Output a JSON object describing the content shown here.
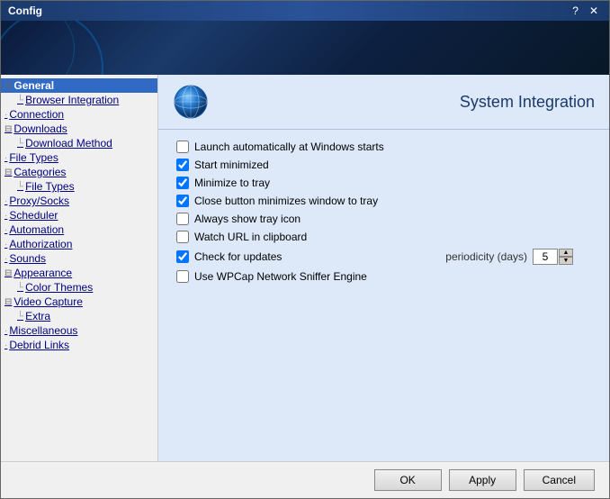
{
  "window": {
    "title": "Config",
    "help_btn": "?",
    "close_btn": "✕"
  },
  "sidebar": {
    "items": [
      {
        "id": "general",
        "label": "General",
        "indent": 0,
        "expand": "□",
        "selected": true,
        "link": true
      },
      {
        "id": "browser-integration",
        "label": "Browser Integration",
        "indent": 1,
        "expand": "",
        "selected": false,
        "link": true
      },
      {
        "id": "connection",
        "label": "Connection",
        "indent": 0,
        "expand": "",
        "selected": false,
        "link": true
      },
      {
        "id": "downloads",
        "label": "Downloads",
        "indent": 0,
        "expand": "□",
        "selected": false,
        "link": true
      },
      {
        "id": "download-method",
        "label": "Download Method",
        "indent": 1,
        "expand": "",
        "selected": false,
        "link": true
      },
      {
        "id": "file-types",
        "label": "File Types",
        "indent": 0,
        "expand": "",
        "selected": false,
        "link": true
      },
      {
        "id": "categories",
        "label": "Categories",
        "indent": 0,
        "expand": "□",
        "selected": false,
        "link": true
      },
      {
        "id": "categories-file-types",
        "label": "File Types",
        "indent": 1,
        "expand": "",
        "selected": false,
        "link": true
      },
      {
        "id": "proxy-socks",
        "label": "Proxy/Socks",
        "indent": 0,
        "expand": "",
        "selected": false,
        "link": true
      },
      {
        "id": "scheduler",
        "label": "Scheduler",
        "indent": 0,
        "expand": "",
        "selected": false,
        "link": true
      },
      {
        "id": "automation",
        "label": "Automation",
        "indent": 0,
        "expand": "",
        "selected": false,
        "link": true
      },
      {
        "id": "authorization",
        "label": "Authorization",
        "indent": 0,
        "expand": "",
        "selected": false,
        "link": true
      },
      {
        "id": "sounds",
        "label": "Sounds",
        "indent": 0,
        "expand": "",
        "selected": false,
        "link": true
      },
      {
        "id": "appearance",
        "label": "Appearance",
        "indent": 0,
        "expand": "□",
        "selected": false,
        "link": true
      },
      {
        "id": "color-themes",
        "label": "Color Themes",
        "indent": 1,
        "expand": "",
        "selected": false,
        "link": true
      },
      {
        "id": "video-capture",
        "label": "Video Capture",
        "indent": 0,
        "expand": "□",
        "selected": false,
        "link": true
      },
      {
        "id": "extra",
        "label": "Extra",
        "indent": 1,
        "expand": "",
        "selected": false,
        "link": true
      },
      {
        "id": "miscellaneous",
        "label": "Miscellaneous",
        "indent": 0,
        "expand": "",
        "selected": false,
        "link": true
      },
      {
        "id": "debrid-links",
        "label": "Debrid Links",
        "indent": 0,
        "expand": "",
        "selected": false,
        "link": true
      }
    ]
  },
  "panel": {
    "title": "System Integration",
    "options": [
      {
        "id": "launch-auto",
        "label": "Launch automatically at Windows starts",
        "checked": false
      },
      {
        "id": "start-minimized",
        "label": "Start minimized",
        "checked": true
      },
      {
        "id": "minimize-tray",
        "label": "Minimize to tray",
        "checked": true
      },
      {
        "id": "close-minimizes",
        "label": "Close button minimizes window to tray",
        "checked": true
      },
      {
        "id": "always-show-tray",
        "label": "Always show tray icon",
        "checked": false
      },
      {
        "id": "watch-url",
        "label": "Watch URL in clipboard",
        "checked": false
      },
      {
        "id": "check-updates",
        "label": "Check for updates",
        "checked": true,
        "has_periodicity": true
      },
      {
        "id": "use-wpcap",
        "label": "Use WPCap Network Sniffer Engine",
        "checked": false
      }
    ],
    "periodicity": {
      "label": "periodicity (days)",
      "value": "5"
    }
  },
  "footer": {
    "ok_label": "OK",
    "apply_label": "Apply",
    "cancel_label": "Cancel"
  }
}
